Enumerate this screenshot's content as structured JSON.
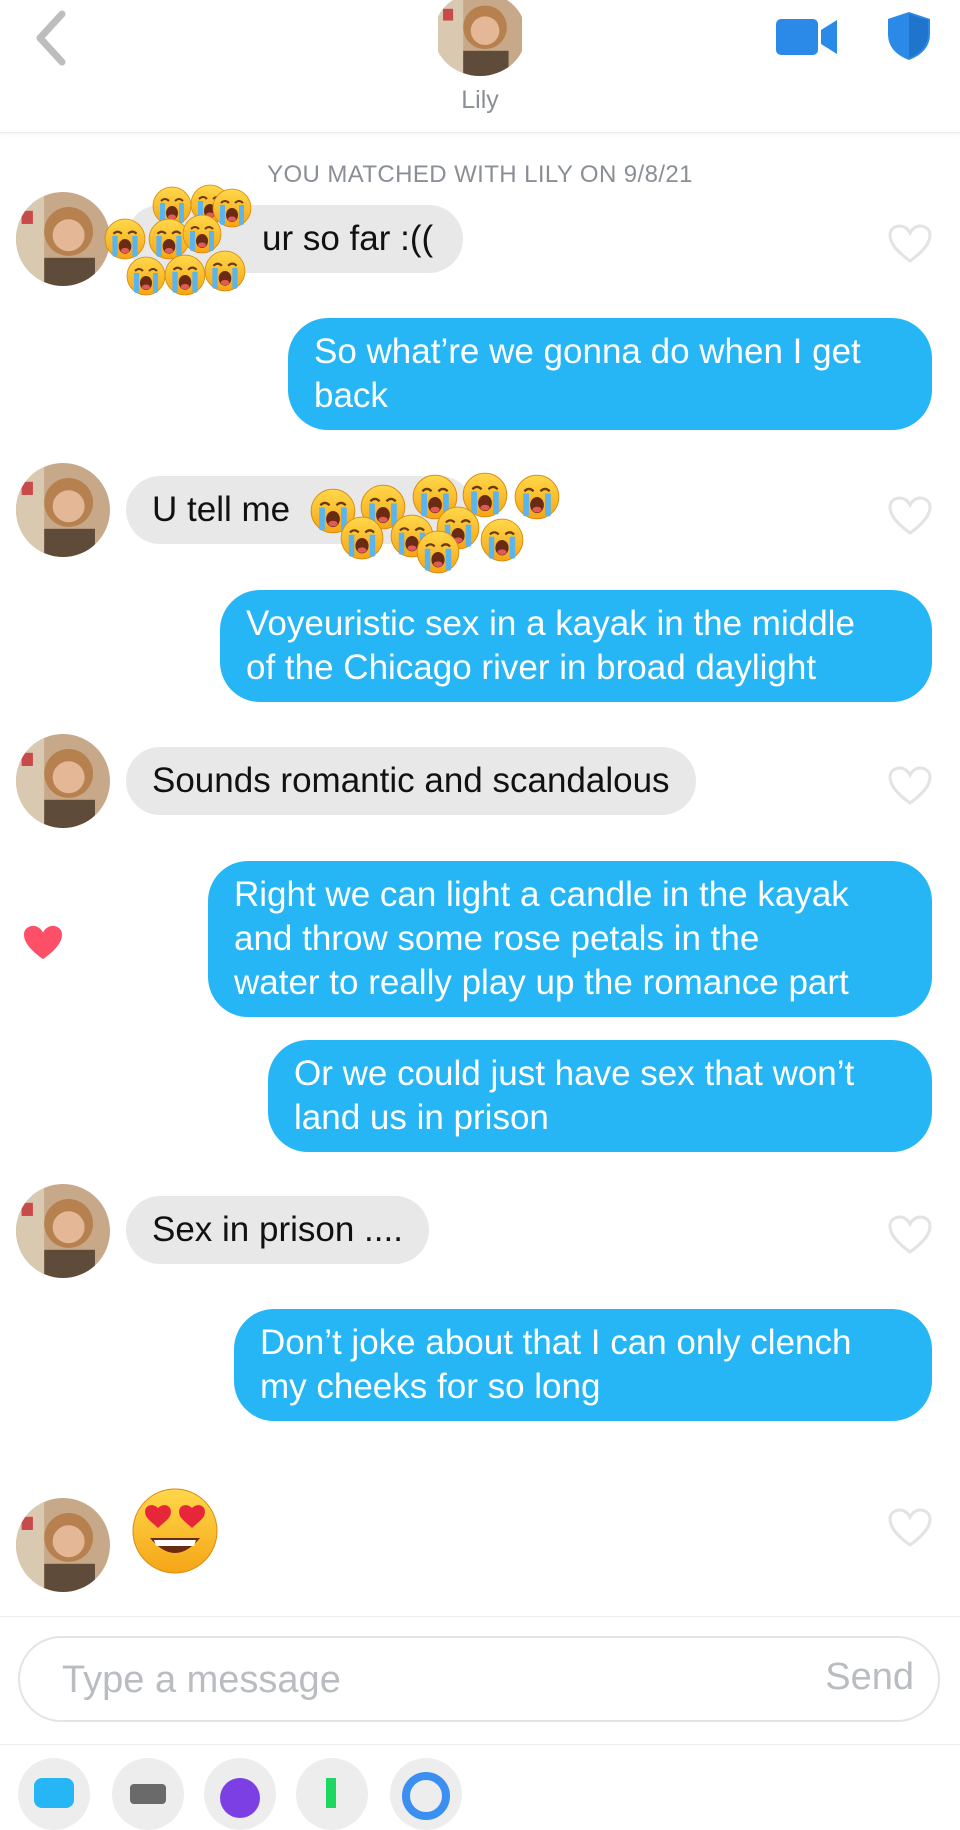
{
  "header": {
    "contact_name": "Lily",
    "back_icon": "chevron-left-icon",
    "video_icon": "video-camera-icon",
    "safety_icon": "shield-icon",
    "accent_color": "#2b8ae8"
  },
  "match_note": "YOU MATCHED WITH LILY ON 9/8/21",
  "messages": [
    {
      "from": "them",
      "text": "ur so far :(("
    },
    {
      "from": "me",
      "lines": [
        "So what’re we gonna do when I get",
        "back"
      ]
    },
    {
      "from": "them",
      "text": "U tell me"
    },
    {
      "from": "me",
      "lines": [
        "Voyeuristic sex in a kayak in the middle",
        "of the Chicago river in broad daylight"
      ]
    },
    {
      "from": "them",
      "text": "Sounds romantic and scandalous"
    },
    {
      "from": "me",
      "lines": [
        "Right we can light a candle in the kayak",
        "and throw some rose petals in the",
        "water to really play up the romance part"
      ],
      "liked": true
    },
    {
      "from": "me",
      "lines": [
        "Or we could just have sex that won’t",
        "land us in prison"
      ]
    },
    {
      "from": "them",
      "text": "Sex in prison ...."
    },
    {
      "from": "me",
      "lines": [
        "Don’t joke about that I can only clench",
        "my cheeks for so long"
      ]
    },
    {
      "from": "them",
      "emoji": "heart-eyes-emoji"
    }
  ],
  "colors": {
    "sent_bubble": "#26b6f6",
    "received_bubble": "#e8e8e8",
    "like_heart": "#fd5068"
  },
  "composer": {
    "placeholder": "Type a message",
    "send_label": "Send"
  },
  "toolbar": {
    "icons": [
      "chat-icon",
      "gif-icon",
      "sticker-icon",
      "music-icon",
      "location-icon"
    ]
  }
}
